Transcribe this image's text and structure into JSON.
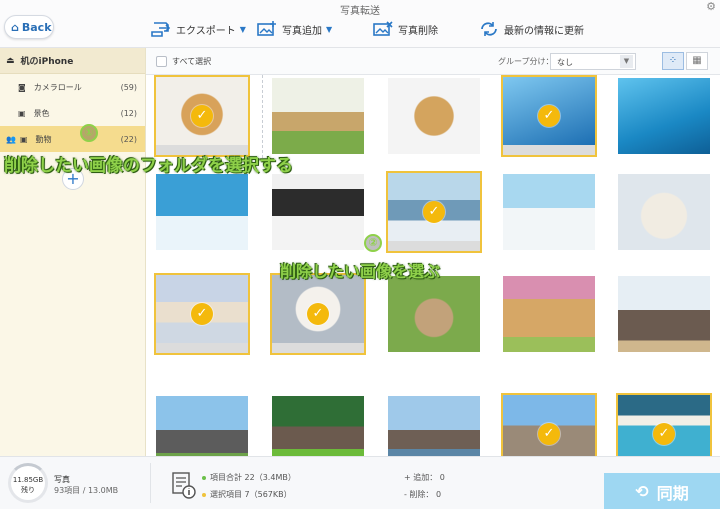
{
  "window": {
    "title": "写真転送",
    "settings_icon": "gear-icon"
  },
  "back": {
    "label": "Back",
    "icon": "home-icon"
  },
  "toolbar": {
    "export": {
      "label": "エクスポート",
      "icon": "export-icon"
    },
    "add": {
      "label": "写真追加",
      "icon": "add-photo-icon"
    },
    "delete": {
      "label": "写真削除",
      "icon": "delete-photo-icon"
    },
    "refresh": {
      "label": "最新の情報に更新",
      "icon": "refresh-icon"
    }
  },
  "sidebar": {
    "device": "机のiPhone",
    "items": [
      {
        "label": "カメラロール",
        "count": "(59)",
        "icon": "camera-icon"
      },
      {
        "label": "景色",
        "count": "(12)",
        "icon": "album-icon"
      },
      {
        "label": "動物",
        "count": "(22)",
        "icon": "album-icon",
        "active": true
      }
    ]
  },
  "gridbar": {
    "select_all": "すべて選択",
    "group_label": "グループ分け：",
    "group_value": "なし"
  },
  "photos": [
    {
      "subject": "golden retriever puppy",
      "selected": true
    },
    {
      "subject": "puppy with flower crown",
      "selected": false
    },
    {
      "subject": "puppy on white",
      "selected": false
    },
    {
      "subject": "dolphin",
      "selected": true
    },
    {
      "subject": "dolphin in sea",
      "selected": false
    },
    {
      "subject": "penguins on ice",
      "selected": false
    },
    {
      "subject": "emperor penguins",
      "selected": false
    },
    {
      "subject": "penguin on ice",
      "selected": true
    },
    {
      "subject": "penguins on snow",
      "selected": false
    },
    {
      "subject": "polar bear cub",
      "selected": false
    },
    {
      "subject": "polar bear at sunset",
      "selected": true
    },
    {
      "subject": "seal pup",
      "selected": true
    },
    {
      "subject": "hedgehog",
      "selected": false
    },
    {
      "subject": "puppy and kitten",
      "selected": false
    },
    {
      "subject": "elephants",
      "selected": false
    },
    {
      "subject": "elephant",
      "selected": false
    },
    {
      "subject": "elephants on grass",
      "selected": false
    },
    {
      "subject": "elephants at water",
      "selected": false
    },
    {
      "subject": "people jumping",
      "selected": true
    },
    {
      "subject": "beach cove",
      "selected": true
    }
  ],
  "annotations": {
    "step1_num": "①",
    "step1_text": "削除したい画像のフォルダを選択する",
    "step2_num": "②",
    "step2_text": "削除したい画像を選ぶ"
  },
  "footer": {
    "storage": "11.85GB",
    "storage_sub": "残り",
    "photo_label": "写真",
    "photo_value": "93項目 / 13.0MB",
    "total": "項目合計 22（3.4MB）",
    "selected": "選択項目 7（567KB）",
    "add": "+ 追加： 0",
    "remove": "- 削除： 0",
    "sync": "同期"
  },
  "colors": {
    "accent": "#2a6fb6",
    "select": "#f0c33c",
    "annotation": "#8fd14a",
    "sync": "#9ed7f2"
  }
}
